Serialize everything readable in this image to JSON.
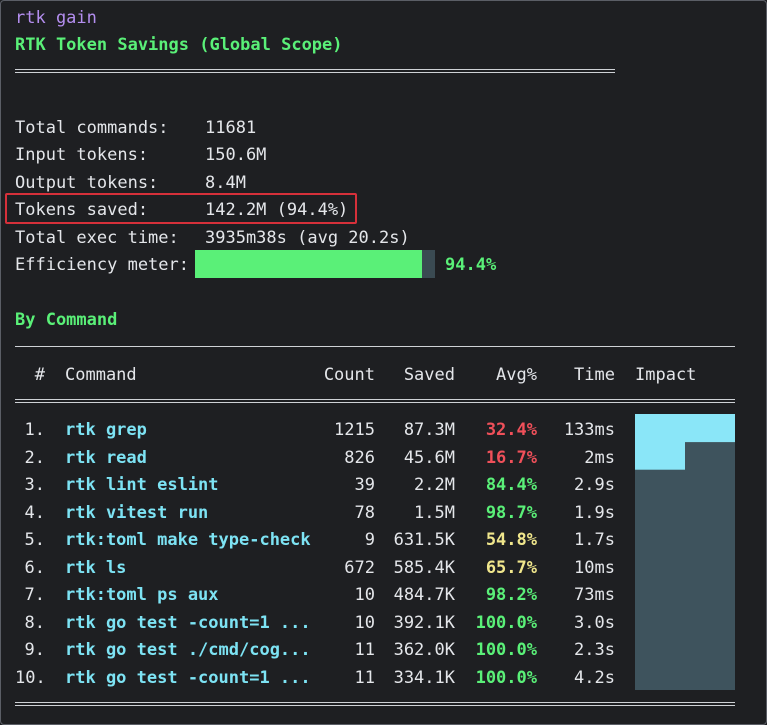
{
  "prompt": {
    "command": "rtk gain"
  },
  "heading": "RTK Token Savings (Global Scope)",
  "stats": [
    {
      "label": "Total commands:",
      "value": "11681"
    },
    {
      "label": "Input tokens:",
      "value": "150.6M"
    },
    {
      "label": "Output tokens:",
      "value": "8.4M"
    },
    {
      "label": "Tokens saved:",
      "value": "142.2M (94.4%)",
      "highlighted": true
    },
    {
      "label": "Total exec time:",
      "value": "3935m38s (avg 20.2s)"
    }
  ],
  "efficiency": {
    "label": "Efficiency meter:",
    "percent_text": "94.4%",
    "level": 0.944
  },
  "section_title": "By Command",
  "table": {
    "headers": {
      "num": "#",
      "command": "Command",
      "count": "Count",
      "saved": "Saved",
      "avg": "Avg%",
      "time": "Time",
      "impact": "Impact"
    },
    "rows": [
      {
        "num": "1.",
        "command": "rtk grep",
        "count": "1215",
        "saved": "87.3M",
        "avg": "32.4%",
        "avg_color": "red",
        "time": "133ms",
        "impact": 1.0
      },
      {
        "num": "2.",
        "command": "rtk read",
        "count": "826",
        "saved": "45.6M",
        "avg": "16.7%",
        "avg_color": "red",
        "time": "2ms",
        "impact": 0.5
      },
      {
        "num": "3.",
        "command": "rtk lint eslint",
        "count": "39",
        "saved": "2.2M",
        "avg": "84.4%",
        "avg_color": "green",
        "time": "2.9s",
        "impact": 0.0
      },
      {
        "num": "4.",
        "command": "rtk vitest run",
        "count": "78",
        "saved": "1.5M",
        "avg": "98.7%",
        "avg_color": "green",
        "time": "1.9s",
        "impact": 0.0
      },
      {
        "num": "5.",
        "command": "rtk:toml make type-check",
        "count": "9",
        "saved": "631.5K",
        "avg": "54.8%",
        "avg_color": "yellow",
        "time": "1.7s",
        "impact": 0.0
      },
      {
        "num": "6.",
        "command": "rtk ls",
        "count": "672",
        "saved": "585.4K",
        "avg": "65.7%",
        "avg_color": "yellow",
        "time": "10ms",
        "impact": 0.0
      },
      {
        "num": "7.",
        "command": "rtk:toml ps aux",
        "count": "10",
        "saved": "484.7K",
        "avg": "98.2%",
        "avg_color": "green",
        "time": "73ms",
        "impact": 0.0
      },
      {
        "num": "8.",
        "command": "rtk go test -count=1 ...",
        "count": "10",
        "saved": "392.1K",
        "avg": "100.0%",
        "avg_color": "green",
        "time": "3.0s",
        "impact": 0.0
      },
      {
        "num": "9.",
        "command": "rtk go test ./cmd/cog...",
        "count": "11",
        "saved": "362.0K",
        "avg": "100.0%",
        "avg_color": "green",
        "time": "2.3s",
        "impact": 0.0
      },
      {
        "num": "10.",
        "command": "rtk go test -count=1 ...",
        "count": "11",
        "saved": "334.1K",
        "avg": "100.0%",
        "avg_color": "green",
        "time": "4.2s",
        "impact": 0.0
      }
    ]
  },
  "colors": {
    "background": "#1e1f22",
    "text": "#e4e6ea",
    "accent_green": "#5af078",
    "command_cyan": "#7de3f4",
    "prompt_purple": "#b48ef0",
    "pct_red": "#f0505a",
    "pct_yellow": "#f0e68c",
    "highlight_red": "#d6303a",
    "impact_fill": "#8ae6f8",
    "impact_track": "#3e535d"
  }
}
